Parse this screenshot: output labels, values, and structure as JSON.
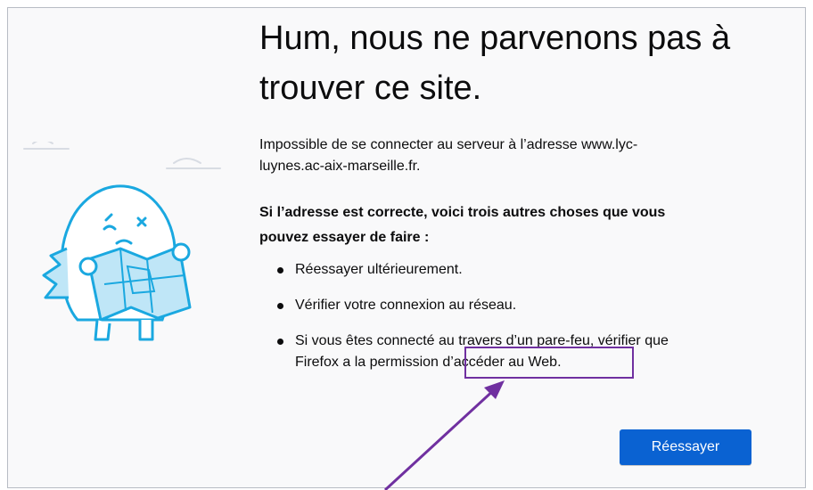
{
  "page": {
    "title_lines": [
      "Hum, nous ne parvenons pas à",
      "trouver ce site."
    ],
    "description_lines": [
      "Impossible de se connecter au serveur à l’adresse www.lyc-",
      "luynes.ac-aix-marseille.fr."
    ],
    "subtitle_lines": [
      "Si l’adresse est correcte, voici trois autres choses que vous",
      "pouvez essayer de faire :"
    ],
    "suggestions": [
      {
        "text": "Réessayer ultérieurement."
      },
      {
        "text": "Vérifier votre connexion au réseau."
      },
      {
        "lines": [
          "Si vous êtes connecté au travers d’un pare-feu, vérifier que",
          "Firefox a la permission d’accéder au Web."
        ]
      }
    ],
    "retry_label": "Réessayer"
  },
  "colors": {
    "retry_button": "#0a62d2",
    "annotation": "#7030a0",
    "illustration_stroke": "#1aa8e0",
    "illustration_fill": "#bfe6f7",
    "background": "#f9f9fa"
  },
  "icons": {
    "illustration": "confused-creature-with-map-illustration"
  }
}
